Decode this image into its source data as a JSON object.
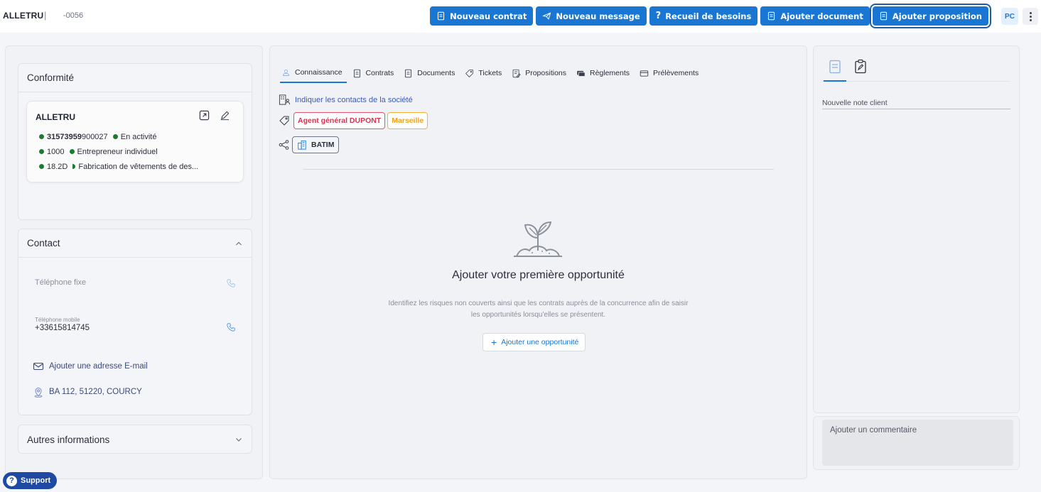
{
  "header": {
    "company_name": "ALLETRU",
    "separator": "|",
    "company_code": "-0056",
    "buttons": [
      {
        "label": "Nouveau contrat",
        "icon": "document-icon"
      },
      {
        "label": "Nouveau message",
        "icon": "send-icon"
      },
      {
        "label": "Recueil de besoins",
        "icon": "question-icon"
      },
      {
        "label": "Ajouter document",
        "icon": "document-icon"
      },
      {
        "label": "Ajouter proposition",
        "icon": "document-icon"
      }
    ],
    "avatar_initials": "PC",
    "accent_color": "#1976d2"
  },
  "conformite": {
    "title": "Conformité",
    "card": {
      "name": "ALLETRU",
      "siret_bold": "31573959",
      "siret_rest": "900027",
      "status": "En activité",
      "legal_code": "1000",
      "legal_form": "Entrepreneur individuel",
      "naf_code": "18.2D",
      "naf_label": "Fabrication de vêtements de des..."
    }
  },
  "contact": {
    "title": "Contact",
    "landline_label": "Téléphone fixe",
    "mobile_label": "Téléphone mobile",
    "mobile_value": "+33615814745",
    "email_link": "Ajouter une adresse E-mail",
    "address": "BA 112, 51220, COURCY"
  },
  "autres": {
    "title": "Autres informations"
  },
  "tabs": [
    {
      "label": "Connaissance",
      "icon": "people-icon"
    },
    {
      "label": "Contrats",
      "icon": "document-icon"
    },
    {
      "label": "Documents",
      "icon": "document-icon"
    },
    {
      "label": "Tickets",
      "icon": "ticket-icon"
    },
    {
      "label": "Propositions",
      "icon": "proposal-icon"
    },
    {
      "label": "Règlements",
      "icon": "payment-icon"
    },
    {
      "label": "Prélèvements",
      "icon": "card-icon"
    }
  ],
  "connaissance": {
    "contacts_link": "Indiquer les contacts de la société",
    "tags": [
      "Agent général DUPONT",
      "Marseille"
    ],
    "group": "BATIM",
    "empty_title": "Ajouter votre première opportunité",
    "empty_desc_line1": "Identifiez les risques non couverts ainsi que les contrats auprès de la concurrence afin de saisir",
    "empty_desc_line2": "les opportunités lorsqu'elles se présentent.",
    "add_button": "Ajouter une opportunité"
  },
  "notes": {
    "note_placeholder": "Nouvelle note client",
    "comment_placeholder": "Ajouter un commentaire"
  },
  "support": {
    "label": "Support"
  }
}
